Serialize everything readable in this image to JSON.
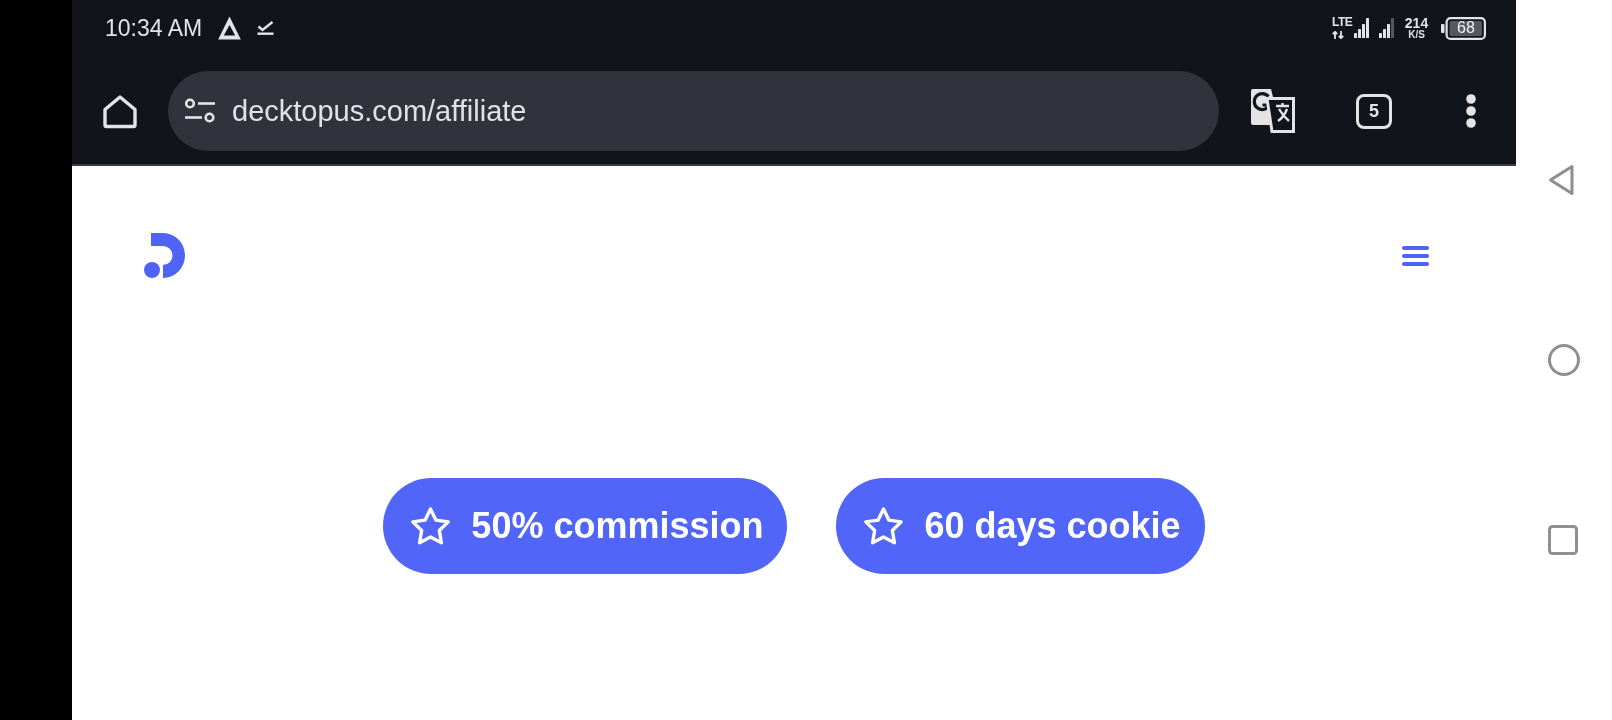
{
  "status_bar": {
    "time": "10:34 AM",
    "network": "LTE",
    "speed": "214",
    "speed_unit": "K/S",
    "battery": "68"
  },
  "browser": {
    "url": "decktopus.com/affiliate",
    "tab_count": "5"
  },
  "page": {
    "badges": [
      {
        "label": "50% commission"
      },
      {
        "label": "60 days cookie"
      }
    ]
  }
}
